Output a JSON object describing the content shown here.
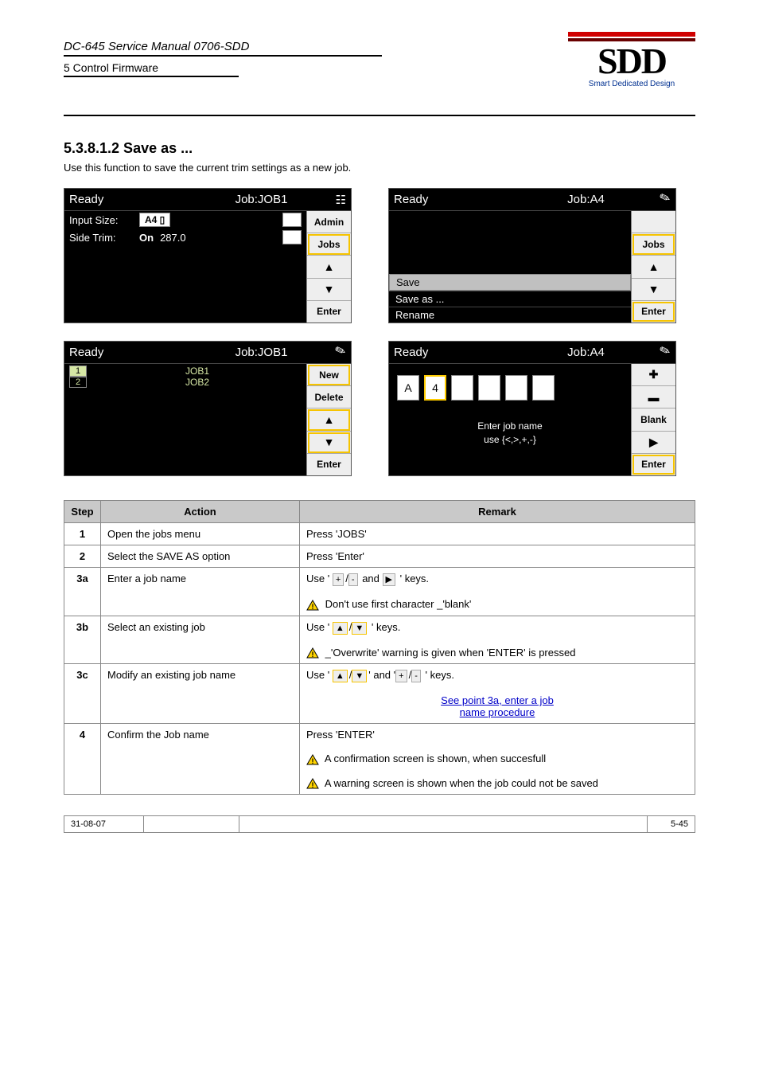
{
  "header": {
    "line1": "DC-645 Service Manual 0706-SDD",
    "line2": "5 Control Firmware",
    "logo_text": "SDD",
    "logo_tag": "Smart Dedicated Design"
  },
  "section": {
    "num": "5.3.8.1.2 Save as ...",
    "lead": "Use this function to save the current trim settings as a new job."
  },
  "screens": {
    "s1": {
      "title_left": "Ready",
      "title_mid": "Job:JOB1",
      "rows": {
        "input_label": "Input Size:",
        "input_value": "A4 ▯",
        "trim_label": "Side Trim:",
        "trim_on": "On",
        "trim_val": "287.0"
      },
      "side": [
        "Admin",
        "Jobs",
        "▲",
        "▼",
        "Enter"
      ]
    },
    "s2": {
      "title_left": "Ready",
      "title_mid": "Job:A4",
      "menu": [
        "Save",
        "Save as ...",
        "Rename"
      ],
      "side": [
        "",
        "Jobs",
        "▲",
        "▼",
        "Enter"
      ]
    },
    "s3": {
      "title_left": "Ready",
      "title_mid": "Job:JOB1",
      "jobs": [
        {
          "idx": "1",
          "name": "JOB1",
          "sel": true
        },
        {
          "idx": "2",
          "name": "JOB2",
          "sel": false
        }
      ],
      "side": [
        "New",
        "Delete",
        "▲",
        "▼",
        "Enter"
      ]
    },
    "s4": {
      "title_left": "Ready",
      "title_mid": "Job:A4",
      "chars": [
        "A",
        "4",
        "",
        "",
        "",
        ""
      ],
      "hint1": "Enter job name",
      "hint2": "use {<,>,+,-}",
      "side": [
        "✚",
        "▬",
        "Blank",
        "▶",
        "Enter"
      ]
    }
  },
  "table": {
    "head": [
      "Step",
      "Action",
      "Remark"
    ],
    "rows": [
      {
        "step": "1",
        "action": "Open the jobs menu",
        "remark": "Press 'JOBS'"
      },
      {
        "step": "2",
        "action": "Select the SAVE AS option",
        "remark": "Press 'Enter'"
      },
      {
        "step": "3a",
        "action": "Enter a job name",
        "remark_pre": "Use '",
        "remark_post": "' keys.",
        "sym": " + / -  and  ▶ ",
        "warn": "Don't use first character _'blank'"
      },
      {
        "step": "3b",
        "action": "Select an existing job",
        "remark_pre": "Use '",
        "remark_post": "' keys.",
        "sym": " ▲ / ▼ ",
        "warn": "_'Overwrite' warning is given when  'ENTER' is pressed"
      },
      {
        "step": "3c",
        "action": "Modify an existing job name",
        "remark_pre": "Use '",
        "remark_post": "' keys.",
        "sym": " ▲ / ▼ ' and ' + / - ",
        "link1": "See point 3a, enter a job",
        "link2": "name procedure"
      },
      {
        "step": "4",
        "action": "Confirm the Job name",
        "remark": "Press 'ENTER'",
        "warn1": "A confirmation screen is shown, when succesfull",
        "warn2": "A warning screen is shown when the job could not be saved"
      }
    ]
  },
  "footer": {
    "left": "31-08-07",
    "mid": "",
    "right": "5-45"
  }
}
